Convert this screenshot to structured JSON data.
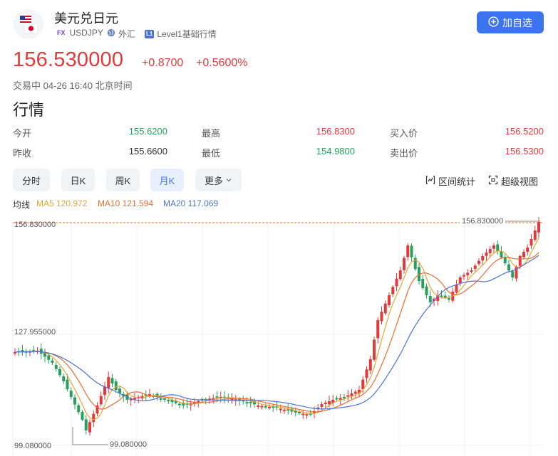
{
  "header": {
    "title": "美元兑日元",
    "fx_tag": "FX",
    "symbol": "USDJPY",
    "category": "外汇",
    "level_tag": "L1",
    "level": "Level1基础行情",
    "add_button": "加自选"
  },
  "quote": {
    "price": "156.530000",
    "change": "+0.8700",
    "change_pct": "+0.5600%",
    "status": "交易中 04-26 16:40 北京时间"
  },
  "section_title": "行情",
  "stats": [
    {
      "label": "今开",
      "value": "155.6200",
      "color": "green"
    },
    {
      "label": "最高",
      "value": "156.8300",
      "color": "red"
    },
    {
      "label": "买入价",
      "value": "156.5200",
      "color": "red"
    },
    {
      "label": "昨收",
      "value": "155.6600",
      "color": "neutral"
    },
    {
      "label": "最低",
      "value": "154.9800",
      "color": "green"
    },
    {
      "label": "卖出价",
      "value": "156.5300",
      "color": "red"
    }
  ],
  "tabs": [
    "分时",
    "日K",
    "周K",
    "月K",
    "更多"
  ],
  "active_tab": "月K",
  "tools": {
    "range_stats": "区间统计",
    "super_view": "超级视图"
  },
  "ma_legend": {
    "label": "均线",
    "ma5": "MA5 120.972",
    "ma10": "MA10 121.594",
    "ma20": "MA20 117.069"
  },
  "colors": {
    "up": "#e2393a",
    "down": "#27a05c",
    "accent": "#3b73f0",
    "ma5": "#e8a531",
    "ma10": "#ef6c2e",
    "ma20": "#4a72d6"
  },
  "chart_data": {
    "type": "candlestick",
    "y_labels": {
      "top": "156.830000",
      "mid": "127.955000",
      "bottom": "99.080000"
    },
    "high_marker": "156.830000",
    "low_marker": "99.080000",
    "ylim": [
      99.08,
      156.83
    ],
    "grid": true
  }
}
